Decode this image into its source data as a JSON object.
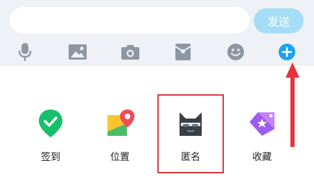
{
  "input_bar": {
    "placeholder": "",
    "send_label": "发送"
  },
  "toolbar": {
    "items": [
      {
        "name": "voice",
        "icon": "microphone-icon"
      },
      {
        "name": "image",
        "icon": "picture-icon"
      },
      {
        "name": "camera",
        "icon": "camera-icon"
      },
      {
        "name": "red-packet",
        "icon": "red-packet-icon"
      },
      {
        "name": "emoji",
        "icon": "smiley-icon"
      },
      {
        "name": "more",
        "icon": "plus-circle-icon"
      }
    ]
  },
  "panel": {
    "items": [
      {
        "label": "签到",
        "icon": "check-location-icon"
      },
      {
        "label": "位置",
        "icon": "map-pin-icon"
      },
      {
        "label": "匿名",
        "icon": "anonymous-cat-icon"
      },
      {
        "label": "收藏",
        "icon": "favorite-tag-icon"
      }
    ]
  },
  "colors": {
    "accent": "#1aa3f0",
    "send_button_bg": "#a6ddf6",
    "toolbar_bg": "#eef1f6",
    "highlight": "#d9363e"
  }
}
